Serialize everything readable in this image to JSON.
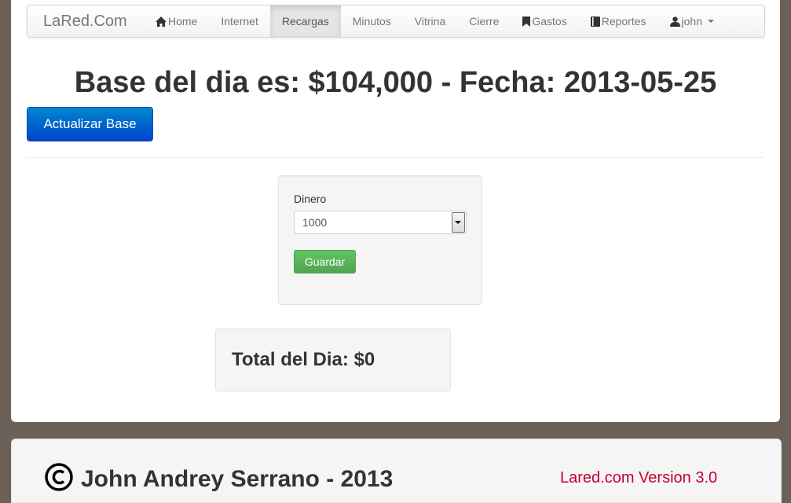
{
  "navbar": {
    "brand": "LaRed.Com",
    "items": [
      {
        "label": "Home",
        "icon": "home-icon"
      },
      {
        "label": "Internet"
      },
      {
        "label": "Recargas",
        "active": true
      },
      {
        "label": "Minutos"
      },
      {
        "label": "Vitrina"
      },
      {
        "label": "Cierre"
      },
      {
        "label": "Gastos",
        "icon": "bookmark-icon"
      },
      {
        "label": "Reportes",
        "icon": "book-icon"
      },
      {
        "label": "john",
        "icon": "user-icon",
        "dropdown": true
      }
    ]
  },
  "main": {
    "title": "Base del dia es: $104,000 - Fecha: 2013-05-25",
    "update_button": "Actualizar Base",
    "form": {
      "label": "Dinero",
      "select_value": "1000",
      "save_button": "Guardar"
    },
    "total": "Total del Dia: $0"
  },
  "footer": {
    "author": "John Andrey Serrano - 2013",
    "version": "Lared.com Version 3.0"
  },
  "colors": {
    "background": "#6b6156",
    "primary": "#0044cc",
    "success": "#51a351",
    "version_text": "#c3002f"
  }
}
